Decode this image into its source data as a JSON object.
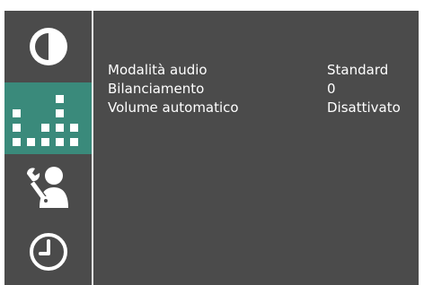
{
  "sidebar": {
    "items": [
      {
        "id": "picture",
        "icon": "contrast-icon",
        "active": false
      },
      {
        "id": "sound",
        "icon": "equalizer-icon",
        "active": true
      },
      {
        "id": "setup",
        "icon": "user-tools-icon",
        "active": false
      },
      {
        "id": "timer",
        "icon": "clock-icon",
        "active": false
      }
    ]
  },
  "menu": {
    "rows": [
      {
        "label": "Modalità audio",
        "value": "Standard"
      },
      {
        "label": "Bilanciamento",
        "value": "0"
      },
      {
        "label": "Volume automatico",
        "value": "Disattivato"
      }
    ]
  },
  "colors": {
    "background": "#4b4b4b",
    "active": "#3a8a7b",
    "text": "#ffffff",
    "divider": "#eaeaea"
  }
}
